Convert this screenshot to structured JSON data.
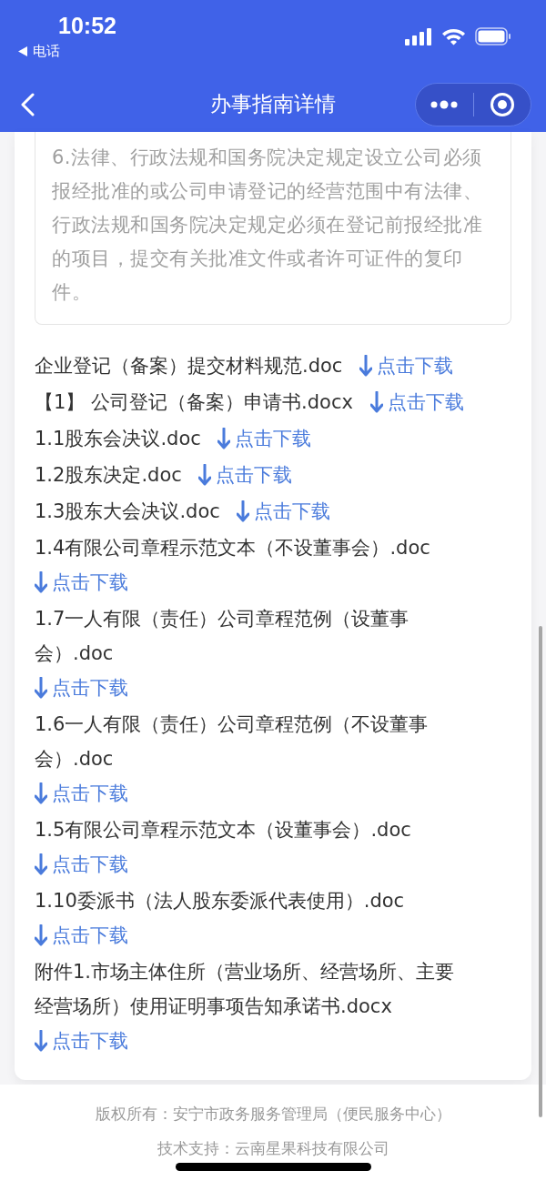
{
  "status_bar": {
    "time": "10:52",
    "back_app": "电话"
  },
  "nav": {
    "title": "办事指南详情"
  },
  "note": {
    "text": "6.法律、行政法规和国务院决定规定设立公司必须报经批准的或公司申请登记的经营范围中有法律、行政法规和国务院决定规定必须在登记前报经批准的项目，提交有关批准文件或者许可证件的复印件。"
  },
  "files": [
    {
      "name": "企业登记（备案）提交材料规范.doc",
      "link": "点击下载"
    },
    {
      "name": "【1】 公司登记（备案）申请书.docx",
      "link": "点击下载"
    },
    {
      "name": "1.1股东会决议.doc",
      "link": "点击下载"
    },
    {
      "name": "1.2股东决定.doc",
      "link": "点击下载"
    },
    {
      "name": "1.3股东大会决议.doc",
      "link": "点击下载"
    },
    {
      "name": "1.4有限公司章程示范文本（不设董事会）.doc",
      "link": "点击下载"
    },
    {
      "name": "1.7一人有限（责任）公司章程范例（设董事会）.doc",
      "link": "点击下载"
    },
    {
      "name": "1.6一人有限（责任）公司章程范例（不设董事会）.doc",
      "link": "点击下载"
    },
    {
      "name": "1.5有限公司章程示范文本（设董事会）.doc",
      "link": "点击下载"
    },
    {
      "name": "1.10委派书（法人股东委派代表使用）.doc",
      "link": "点击下载"
    },
    {
      "name": "附件1.市场主体住所（营业场所、经营场所、主要经营场所）使用证明事项告知承诺书.docx",
      "link": "点击下载"
    }
  ],
  "footer": [
    "版权所有：安宁市政务服务管理局（便民服务中心）",
    "技术支持：云南星果科技有限公司"
  ]
}
